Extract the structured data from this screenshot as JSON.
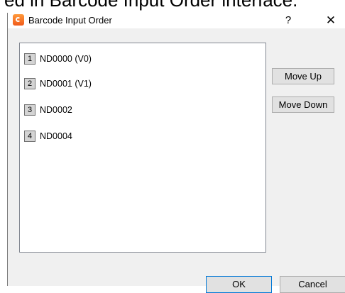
{
  "caption": "ed in Barcode Input Order interface.",
  "window": {
    "title": "Barcode Input Order",
    "help": "?",
    "close": "✕"
  },
  "list": {
    "items": [
      {
        "index": "1",
        "label": "ND0000 (V0)"
      },
      {
        "index": "2",
        "label": "ND0001 (V1)"
      },
      {
        "index": "3",
        "label": "ND0002"
      },
      {
        "index": "4",
        "label": "ND0004"
      }
    ]
  },
  "buttons": {
    "move_up": "Move Up",
    "move_down": "Move Down",
    "ok": "OK",
    "cancel": "Cancel"
  }
}
